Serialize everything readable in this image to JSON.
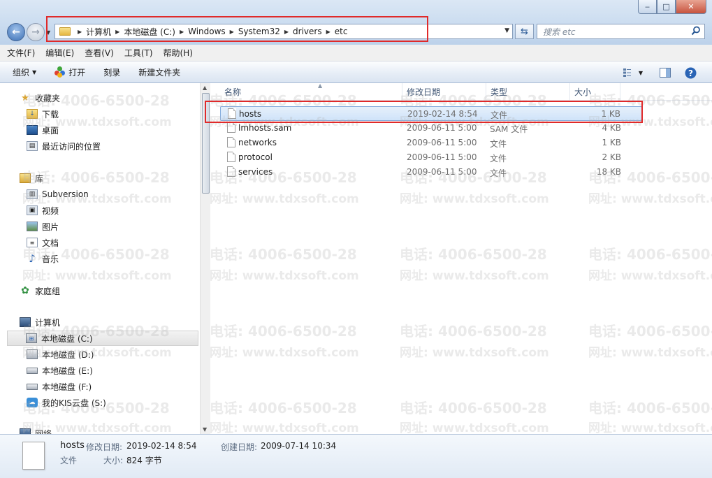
{
  "window": {
    "minimize": "‒",
    "maximize": "□",
    "close": "✕"
  },
  "address": {
    "crumbs": [
      "计算机",
      "本地磁盘 (C:)",
      "Windows",
      "System32",
      "drivers",
      "etc"
    ],
    "search_placeholder": "搜索 etc"
  },
  "menu": [
    "文件(F)",
    "编辑(E)",
    "查看(V)",
    "工具(T)",
    "帮助(H)"
  ],
  "toolbar": {
    "organize": "组织",
    "open": "打开",
    "burn": "刻录",
    "new_folder": "新建文件夹",
    "icons": [
      "view-icon",
      "preview-pane-icon",
      "help-icon"
    ]
  },
  "nav": {
    "favorites": "收藏夹",
    "downloads": "下载",
    "desktop": "桌面",
    "recent": "最近访问的位置",
    "libraries": "库",
    "subversion": "Subversion",
    "videos": "视频",
    "pictures": "图片",
    "documents": "文档",
    "music": "音乐",
    "homegroup": "家庭组",
    "computer": "计算机",
    "drive_c": "本地磁盘 (C:)",
    "drive_d": "本地磁盘 (D:)",
    "drive_e": "本地磁盘 (E:)",
    "drive_f": "本地磁盘 (F:)",
    "kis": "我的KIS云盘 (S:)",
    "network": "网络"
  },
  "columns": {
    "name": "名称",
    "modified": "修改日期",
    "type": "类型",
    "size": "大小"
  },
  "files": [
    {
      "name": "hosts",
      "modified": "2019-02-14 8:54",
      "type": "文件",
      "size": "1 KB",
      "selected": true
    },
    {
      "name": "lmhosts.sam",
      "modified": "2009-06-11 5:00",
      "type": "SAM 文件",
      "size": "4 KB",
      "selected": false
    },
    {
      "name": "networks",
      "modified": "2009-06-11 5:00",
      "type": "文件",
      "size": "1 KB",
      "selected": false
    },
    {
      "name": "protocol",
      "modified": "2009-06-11 5:00",
      "type": "文件",
      "size": "2 KB",
      "selected": false
    },
    {
      "name": "services",
      "modified": "2009-06-11 5:00",
      "type": "文件",
      "size": "18 KB",
      "selected": false
    }
  ],
  "details": {
    "name": "hosts",
    "modified_label": "修改日期:",
    "modified": "2019-02-14 8:54",
    "created_label": "创建日期:",
    "created": "2009-07-14 10:34",
    "type": "文件",
    "size_label": "大小:",
    "size": "824 字节"
  },
  "watermark": {
    "phone": "电话: 4006-6500-28",
    "site": "网址: www.tdxsoft.com"
  },
  "colors": {
    "annotation": "#e02a2a",
    "selection": "#cfe3f9"
  }
}
